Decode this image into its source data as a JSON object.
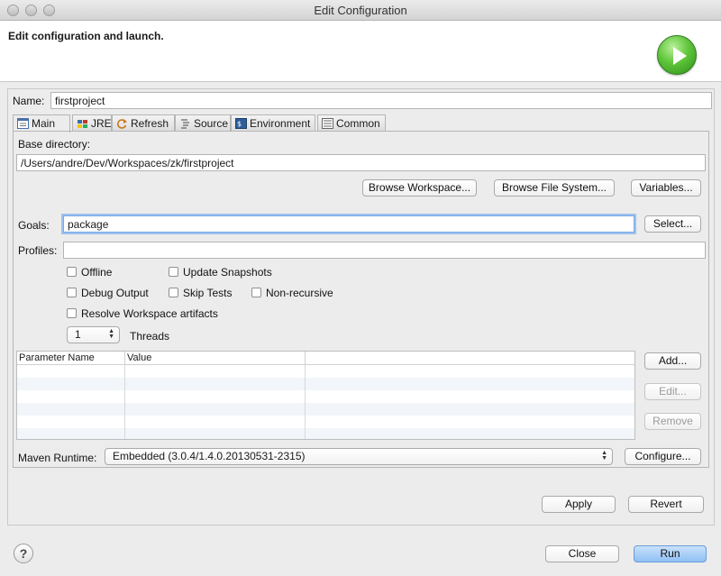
{
  "window": {
    "title": "Edit Configuration"
  },
  "banner": {
    "title": "Edit configuration and launch.",
    "icon": "run-play-icon"
  },
  "name": {
    "label": "Name:",
    "value": "firstproject"
  },
  "tabs": [
    {
      "label": "Main",
      "icon": "main-tab-icon"
    },
    {
      "label": "JRE",
      "icon": "jre-icon"
    },
    {
      "label": "Refresh",
      "icon": "refresh-icon"
    },
    {
      "label": "Source",
      "icon": "source-icon"
    },
    {
      "label": "Environment",
      "icon": "environment-icon"
    },
    {
      "label": "Common",
      "icon": "common-icon"
    }
  ],
  "main": {
    "base_dir_label": "Base directory:",
    "base_dir_value": "/Users/andre/Dev/Workspaces/zk/firstproject",
    "browse_workspace": "Browse Workspace...",
    "browse_fs": "Browse File System...",
    "variables": "Variables...",
    "goals_label": "Goals:",
    "goals_value": "package",
    "select": "Select...",
    "profiles_label": "Profiles:",
    "profiles_value": "",
    "offline": "Offline",
    "update_snapshots": "Update Snapshots",
    "debug_output": "Debug Output",
    "skip_tests": "Skip Tests",
    "non_recursive": "Non-recursive",
    "resolve_ws": "Resolve Workspace artifacts",
    "threads_value": "1",
    "threads_label": "Threads",
    "params": {
      "col_name": "Parameter Name",
      "col_value": "Value",
      "rows": []
    },
    "add": "Add...",
    "edit": "Edit...",
    "remove": "Remove",
    "runtime_label": "Maven Runtime:",
    "runtime_value": "Embedded (3.0.4/1.4.0.20130531-2315)",
    "configure": "Configure..."
  },
  "apply": "Apply",
  "revert": "Revert",
  "close": "Close",
  "run": "Run",
  "help": "?"
}
